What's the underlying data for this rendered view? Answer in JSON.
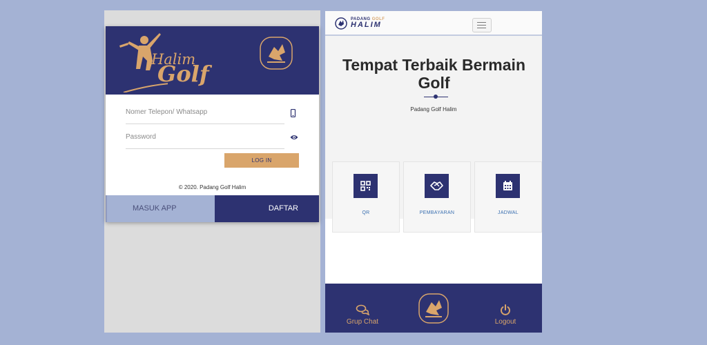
{
  "login": {
    "brand": {
      "top": "Halim",
      "bottom": "Golf"
    },
    "phone_placeholder": "Nomer Telepon/ Whatsapp",
    "password_placeholder": "Password",
    "login_button": "LOG IN",
    "copyright": "© 2020. Padang Golf Halim",
    "tabs": {
      "masuk": "MASUK APP",
      "daftar": "DAFTAR"
    },
    "icons": {
      "phone": "smartphone-icon",
      "password": "eye-icon"
    }
  },
  "app": {
    "nav": {
      "logo_top_left": "PADANG",
      "logo_top_right": "GOLF",
      "logo_bottom": "HALIM",
      "menu_icon": "hamburger-icon"
    },
    "hero": {
      "title": "Tempat Terbaik Bermain Golf",
      "subtitle": "Padang Golf Halim"
    },
    "tiles": [
      {
        "label": "QR",
        "icon": "qr-icon"
      },
      {
        "label": "PEMBAYARAN",
        "icon": "handshake-icon"
      },
      {
        "label": "JADWAL",
        "icon": "calendar-icon"
      }
    ],
    "bottom_nav": {
      "chat": {
        "label": "Grup Chat",
        "icon": "chat-icon"
      },
      "logout": {
        "label": "Logout",
        "icon": "power-icon"
      }
    }
  },
  "colors": {
    "background": "#a4b2d4",
    "navy": "#2d3271",
    "gold": "#d9a56b",
    "link_blue": "#3a6fb0"
  }
}
